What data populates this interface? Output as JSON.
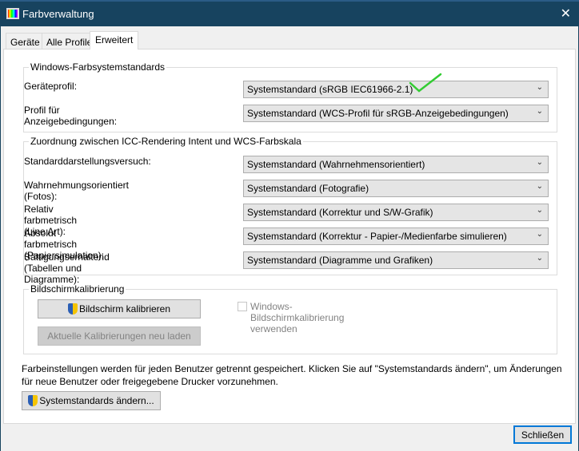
{
  "window": {
    "title": "Farbverwaltung",
    "close": "✕"
  },
  "tabs": [
    {
      "label": "Geräte"
    },
    {
      "label": "Alle Profile"
    },
    {
      "label": "Erweitert"
    }
  ],
  "group1": {
    "legend": "Windows-Farbsystemstandards",
    "rows": [
      {
        "label": "Geräteprofil:",
        "value": "Systemstandard (sRGB IEC61966-2.1)"
      },
      {
        "label": "Profil für Anzeigebedingungen:",
        "value": "Systemstandard (WCS-Profil für sRGB-Anzeigebedingungen)"
      }
    ]
  },
  "group2": {
    "legend": "Zuordnung zwischen ICC-Rendering Intent und WCS-Farbskala",
    "rows": [
      {
        "label": "Standarddarstellungsversuch:",
        "value": "Systemstandard (Wahrnehmensorientiert)"
      },
      {
        "label": "Wahrnehmungsorientiert (Fotos):",
        "value": "Systemstandard (Fotografie)"
      },
      {
        "label": "Relativ farbmetrisch (Line Art):",
        "value": "Systemstandard (Korrektur und S/W-Grafik)"
      },
      {
        "label": "Absolut farbmetrisch (Papiersimulation):",
        "value": "Systemstandard (Korrektur - Papier-/Medienfarbe simulieren)"
      },
      {
        "label": "Sättigungserhaltend (Tabellen und Diagramme):",
        "value": "Systemstandard (Diagramme und Grafiken)"
      }
    ]
  },
  "group3": {
    "legend": "Bildschirmkalibrierung",
    "calibrate": "Bildschirm kalibrieren",
    "reload": "Aktuelle Kalibrierungen neu laden",
    "checkbox": "Windows-Bildschirmkalibrierung verwenden",
    "checked": false
  },
  "info": "Farbeinstellungen werden für jeden Benutzer getrennt gespeichert. Klicken Sie auf \"Systemstandards ändern\", um Änderungen für neue Benutzer oder freigegebene Drucker vorzunehmen.",
  "change_defaults": "Systemstandards ändern...",
  "close_button": "Schließen",
  "annotation_color": "#33cc33"
}
